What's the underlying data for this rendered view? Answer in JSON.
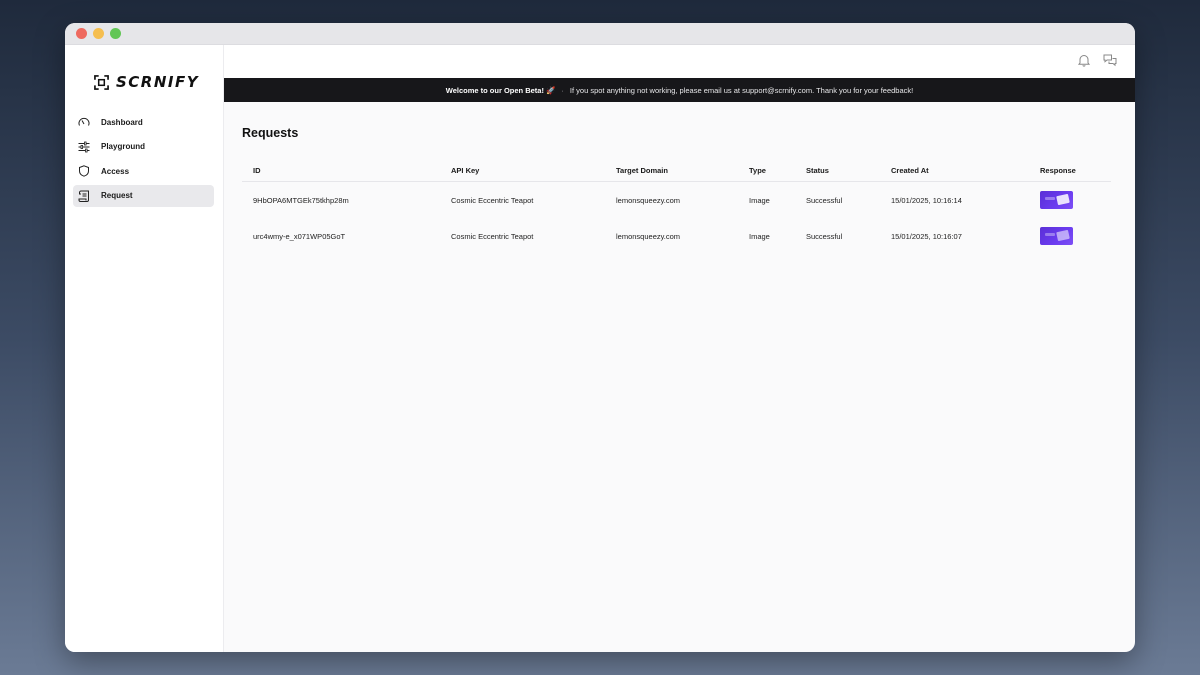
{
  "app": {
    "name": "SCRNIFY"
  },
  "sidebar": {
    "items": [
      {
        "label": "Dashboard",
        "icon": "gauge-icon",
        "active": false
      },
      {
        "label": "Playground",
        "icon": "sliders-icon",
        "active": false
      },
      {
        "label": "Access",
        "icon": "shield-icon",
        "active": false
      },
      {
        "label": "Request",
        "icon": "scroll-icon",
        "active": true
      }
    ]
  },
  "topbar": {
    "icons": [
      "bell-icon",
      "chat-icon"
    ]
  },
  "banner": {
    "title": "Welcome to our Open Beta! 🚀",
    "separator": "·",
    "message": "If you spot anything not working, please email us at support@scrnify.com. Thank you for your feedback!"
  },
  "page": {
    "title": "Requests"
  },
  "table": {
    "headers": {
      "id": "ID",
      "api_key": "API Key",
      "target_domain": "Target Domain",
      "type": "Type",
      "status": "Status",
      "created_at": "Created At",
      "response": "Response"
    },
    "rows": [
      {
        "id": "9HbOPA6MTGEk75tkhp28m",
        "api_key": "Cosmic Eccentric Teapot",
        "target_domain": "lemonsqueezy.com",
        "type": "Image",
        "status": "Successful",
        "created_at": "15/01/2025, 10:16:14"
      },
      {
        "id": "urc4wmy-e_x071WP05GoT",
        "api_key": "Cosmic Eccentric Teapot",
        "target_domain": "lemonsqueezy.com",
        "type": "Image",
        "status": "Successful",
        "created_at": "15/01/2025, 10:16:07"
      }
    ]
  },
  "colors": {
    "banner_bg": "#17171a",
    "thumbnail_accent": "#6b3cf0",
    "active_nav_bg": "#e9e9ec"
  }
}
